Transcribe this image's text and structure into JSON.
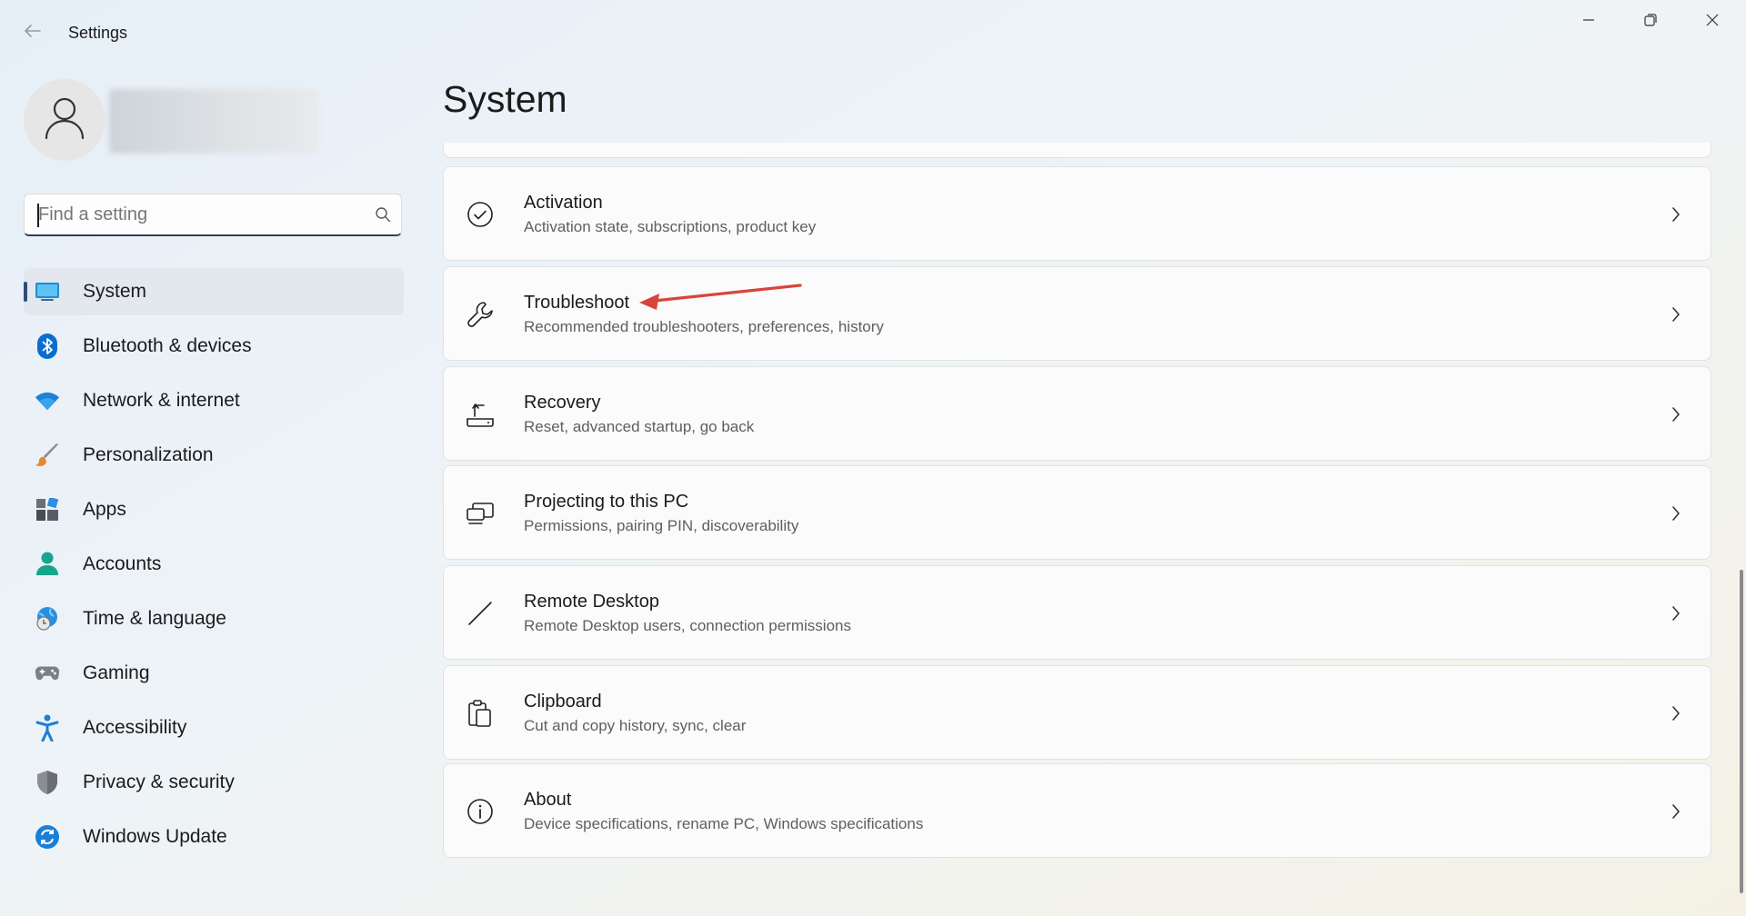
{
  "window": {
    "title": "Settings",
    "controls": [
      "minimize-icon",
      "restore-icon",
      "close-icon"
    ]
  },
  "search": {
    "placeholder": "Find a setting",
    "value": ""
  },
  "sidebar": {
    "items": [
      {
        "label": "System",
        "icon": "system-display-icon",
        "active": true
      },
      {
        "label": "Bluetooth & devices",
        "icon": "bluetooth-icon"
      },
      {
        "label": "Network & internet",
        "icon": "wifi-icon"
      },
      {
        "label": "Personalization",
        "icon": "paintbrush-icon"
      },
      {
        "label": "Apps",
        "icon": "apps-icon"
      },
      {
        "label": "Accounts",
        "icon": "accounts-icon"
      },
      {
        "label": "Time & language",
        "icon": "globe-clock-icon"
      },
      {
        "label": "Gaming",
        "icon": "gamepad-icon"
      },
      {
        "label": "Accessibility",
        "icon": "accessibility-icon"
      },
      {
        "label": "Privacy & security",
        "icon": "shield-icon"
      },
      {
        "label": "Windows Update",
        "icon": "update-icon"
      }
    ]
  },
  "main": {
    "title": "System",
    "cards": [
      {
        "title": "Activation",
        "subtitle": "Activation state, subscriptions, product key",
        "icon": "check-circle-icon"
      },
      {
        "title": "Troubleshoot",
        "subtitle": "Recommended troubleshooters, preferences, history",
        "icon": "wrench-icon"
      },
      {
        "title": "Recovery",
        "subtitle": "Reset, advanced startup, go back",
        "icon": "recovery-icon"
      },
      {
        "title": "Projecting to this PC",
        "subtitle": "Permissions, pairing PIN, discoverability",
        "icon": "projecting-icon"
      },
      {
        "title": "Remote Desktop",
        "subtitle": "Remote Desktop users, connection permissions",
        "icon": "remote-desktop-icon"
      },
      {
        "title": "Clipboard",
        "subtitle": "Cut and copy history, sync, clear",
        "icon": "clipboard-icon"
      },
      {
        "title": "About",
        "subtitle": "Device specifications, rename PC, Windows specifications",
        "icon": "info-icon"
      }
    ]
  },
  "colors": {
    "accent": "#2c4d7a",
    "annotation_arrow": "#d9443a",
    "bluetooth": "#0a6ed1",
    "accounts": "#1aa68a"
  }
}
